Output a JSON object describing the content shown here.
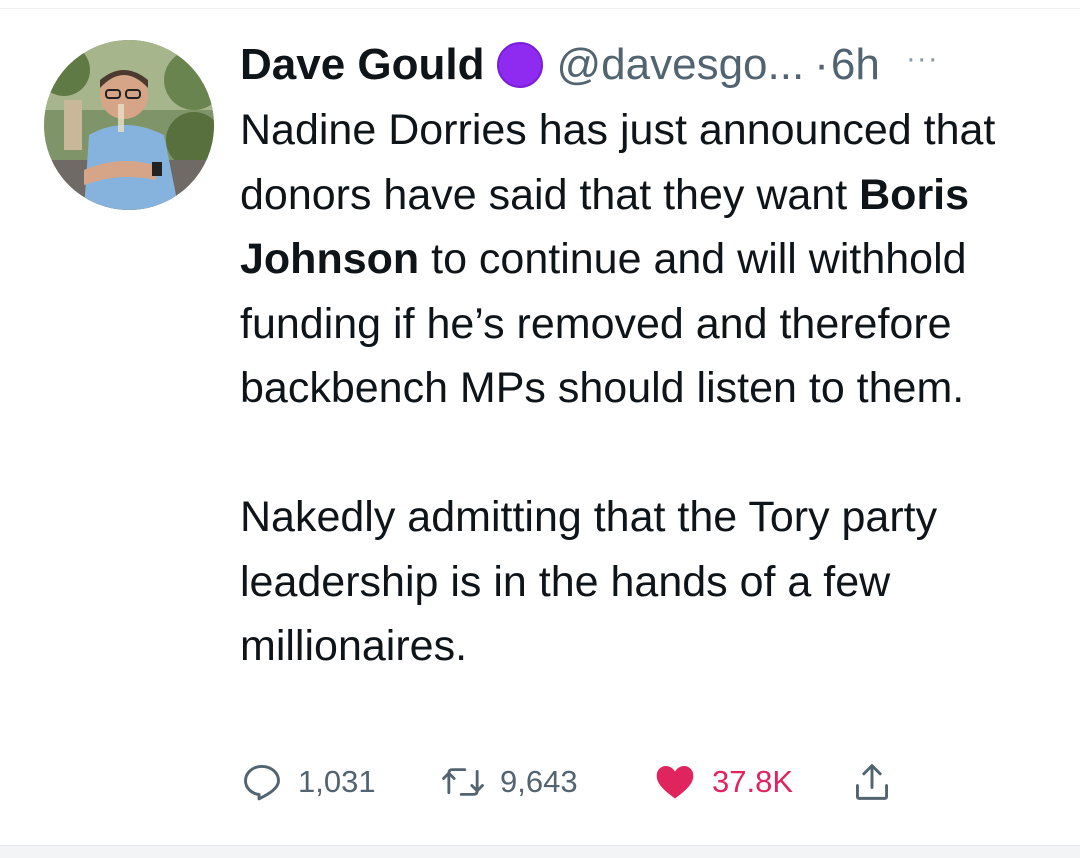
{
  "tweet": {
    "author": {
      "display_name": "Dave Gould",
      "badge_color": "#8f2bf0",
      "handle": "@davesgo...",
      "separator": "·",
      "time": "6h",
      "more": "···"
    },
    "body": {
      "p1_pre": "Nadine Dorries has just announced that donors have said that they want ",
      "p1_bold": "Boris Johnson",
      "p1_post": " to continue and will withhold funding if he’s removed and therefore backbench MPs should listen to them.",
      "p2": "Nakedly admitting that the Tory party leadership is in the hands of a few millionaires."
    },
    "actions": {
      "reply_count": "1,031",
      "retweet_count": "9,643",
      "like_count": "37.8K",
      "like_color": "#e0245e",
      "icons": [
        "reply-icon",
        "retweet-icon",
        "heart-icon",
        "share-icon"
      ]
    }
  }
}
